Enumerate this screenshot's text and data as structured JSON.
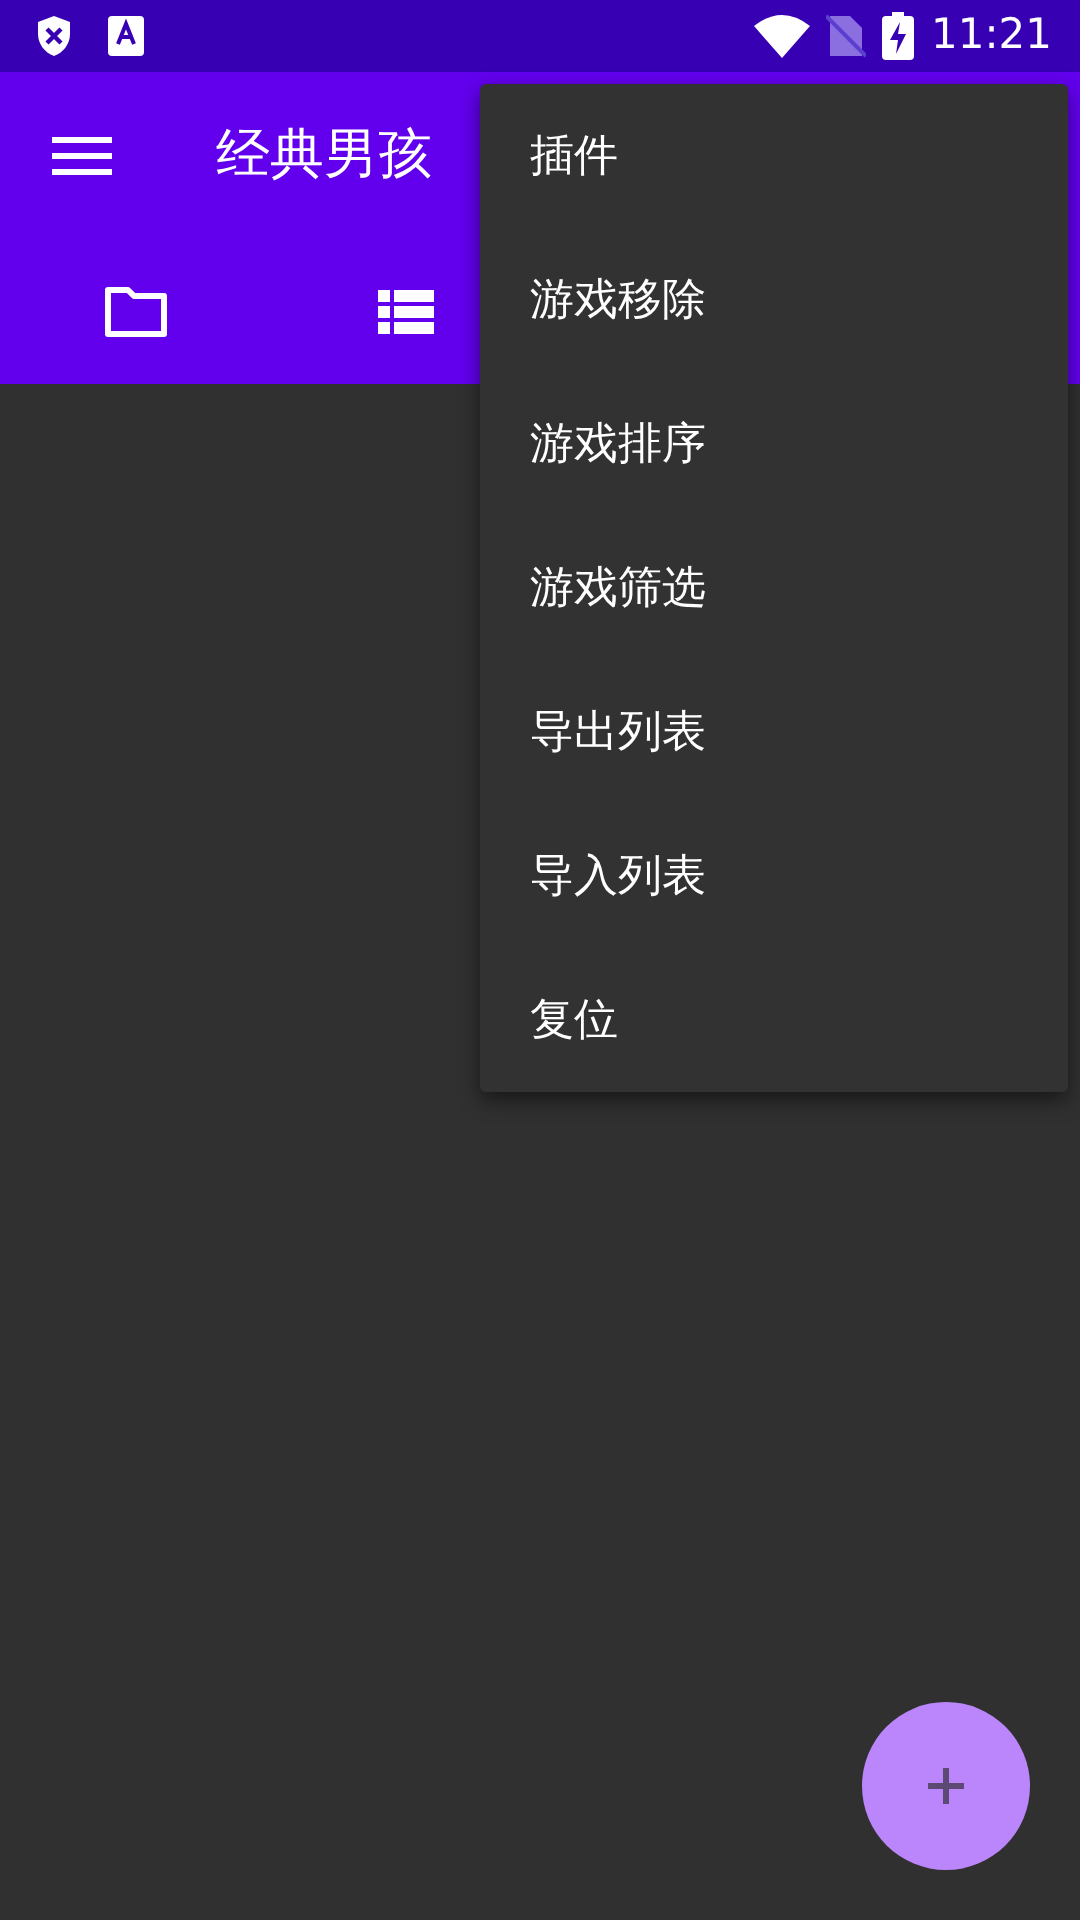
{
  "status_bar": {
    "time": "11:21"
  },
  "app_bar": {
    "title": "经典男孩"
  },
  "tabs": [
    {
      "kind": "folder"
    },
    {
      "kind": "list"
    }
  ],
  "menu": {
    "items": [
      {
        "label": "插件"
      },
      {
        "label": "游戏移除"
      },
      {
        "label": "游戏排序"
      },
      {
        "label": "游戏筛选"
      },
      {
        "label": "导出列表"
      },
      {
        "label": "导入列表"
      },
      {
        "label": "复位"
      }
    ]
  }
}
